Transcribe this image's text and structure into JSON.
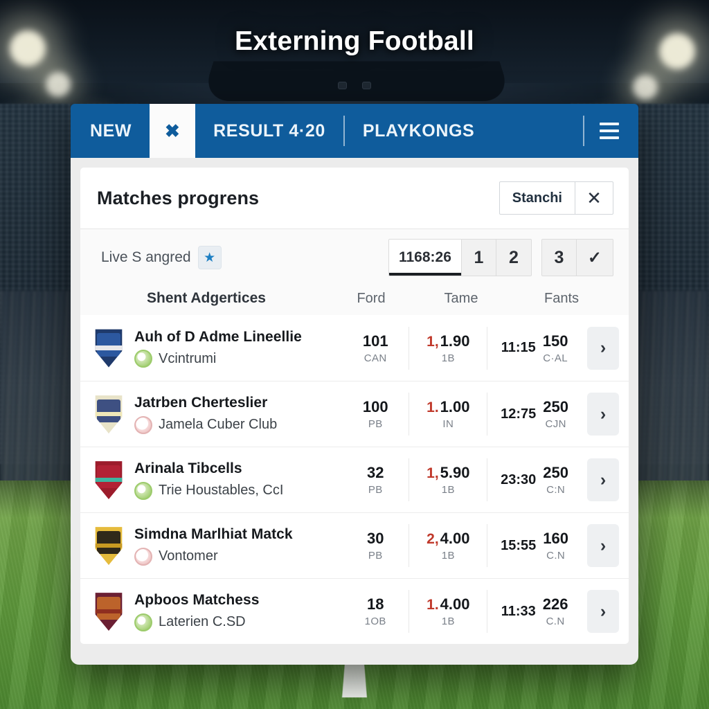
{
  "hero": {
    "title": "Externing Football"
  },
  "navbar": {
    "new_label": "NEW",
    "close_tab_icon": "✖",
    "result_label": "RESULT 4·20",
    "playkongs_label": "PLAYKONGS",
    "menu_icon": "hamburger-menu-icon"
  },
  "panel": {
    "title": "Matches progrens",
    "stanchi_label": "Stanchi",
    "close_label": "✕"
  },
  "subbar": {
    "live_label": "Live S angred",
    "star_icon": "★",
    "segments": [
      {
        "label": "1168:26",
        "active": true
      },
      {
        "label": "1",
        "active": false
      },
      {
        "label": "2",
        "active": false
      }
    ],
    "segments2": [
      {
        "label": "3",
        "active": false
      },
      {
        "label": "✓",
        "active": false
      }
    ]
  },
  "table": {
    "headers": {
      "main": "Shent Adgertices",
      "a": "Ford",
      "b": "Tame",
      "c": "Fants"
    },
    "rows": [
      {
        "crest": {
          "base": "#1f3a6b",
          "inner": "#2d5ca5",
          "accent": "#e8e8ea"
        },
        "name": "Auh of D Adme Lineellie",
        "sub": "Vcintrumi",
        "sub_icon": "green",
        "a_value": "101",
        "a_label": "CAN",
        "b_prefix": "1,",
        "b_value": "1.90",
        "b_label": "1B",
        "c_time": "11:15",
        "c_value": "150",
        "c_label": "C·AL",
        "chevron": "›"
      },
      {
        "crest": {
          "base": "#e8e3c8",
          "inner": "#2b3f7a",
          "accent": "#f0e8b8"
        },
        "name": "Jatrben Cherteslier",
        "sub": "Jamela Cuber Club",
        "sub_icon": "pink",
        "a_value": "100",
        "a_label": "PB",
        "b_prefix": "1.",
        "b_value": "1.00",
        "b_label": "IN",
        "c_time": "12:75",
        "c_value": "250",
        "c_label": "CJN",
        "chevron": "›"
      },
      {
        "crest": {
          "base": "#9c1c2b",
          "inner": "#b52436",
          "accent": "#3fb5a0"
        },
        "name": "Arinala Tibcells",
        "sub": "Trie Houstables, CcI",
        "sub_icon": "green",
        "a_value": "32",
        "a_label": "PB",
        "b_prefix": "1,",
        "b_value": "5.90",
        "b_label": "1B",
        "c_time": "23:30",
        "c_value": "250",
        "c_label": "C:N",
        "chevron": "›"
      },
      {
        "crest": {
          "base": "#e5bb3c",
          "inner": "#1c1a16",
          "accent": "#c99a22"
        },
        "name": "Simdna Marlhiat Matck",
        "sub": "Vontomer",
        "sub_icon": "pink",
        "a_value": "30",
        "a_label": "PB",
        "b_prefix": "2,",
        "b_value": "4.00",
        "b_label": "1B",
        "c_time": "15:55",
        "c_value": "160",
        "c_label": "C.N",
        "chevron": "›"
      },
      {
        "crest": {
          "base": "#6b1f33",
          "inner": "#c56a2a",
          "accent": "#8f2f20"
        },
        "name": "Apboos Matchess",
        "sub": "Laterien C.SD",
        "sub_icon": "green",
        "a_value": "18",
        "a_label": "1OB",
        "b_prefix": "1.",
        "b_value": "4.00",
        "b_label": "1B",
        "c_time": "11:33",
        "c_value": "226",
        "c_label": "C.N",
        "chevron": "›"
      }
    ]
  }
}
